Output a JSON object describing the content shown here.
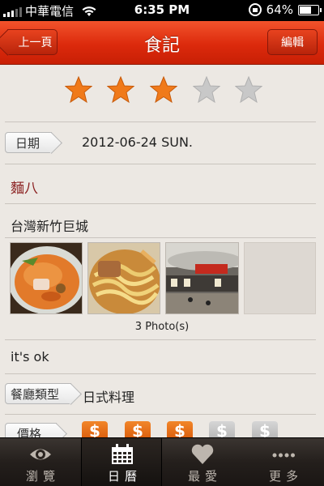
{
  "status": {
    "carrier": "中華電信",
    "time": "6:35 PM",
    "battery": "64%",
    "battery_level": 0.64
  },
  "nav": {
    "back_label": "上一頁",
    "title": "食記",
    "edit_label": "編輯"
  },
  "rating": {
    "value": 3,
    "max": 5
  },
  "date": {
    "label": "日期",
    "value": "2012-06-24 SUN."
  },
  "restaurant": {
    "name": "麵八",
    "location": "台灣新竹巨城"
  },
  "photos": {
    "count_label": "3 Photo(s)",
    "items": [
      "ramen-photo",
      "noodles-photo",
      "mall-photo"
    ]
  },
  "comment": "it's ok",
  "category": {
    "label": "餐廳類型",
    "value": "日式料理"
  },
  "price": {
    "label": "價格",
    "value": 3,
    "max": 5
  },
  "tabs": [
    {
      "label": "瀏覽",
      "icon": "eye-icon"
    },
    {
      "label": "日曆",
      "icon": "calendar-icon"
    },
    {
      "label": "最愛",
      "icon": "heart-icon"
    },
    {
      "label": "更多",
      "icon": "more-dots-icon"
    }
  ],
  "colors": {
    "accent": "#e0350f",
    "star_on": "#f07a1a",
    "star_off": "#c8c8c8",
    "name_text": "#8a1f1f"
  }
}
